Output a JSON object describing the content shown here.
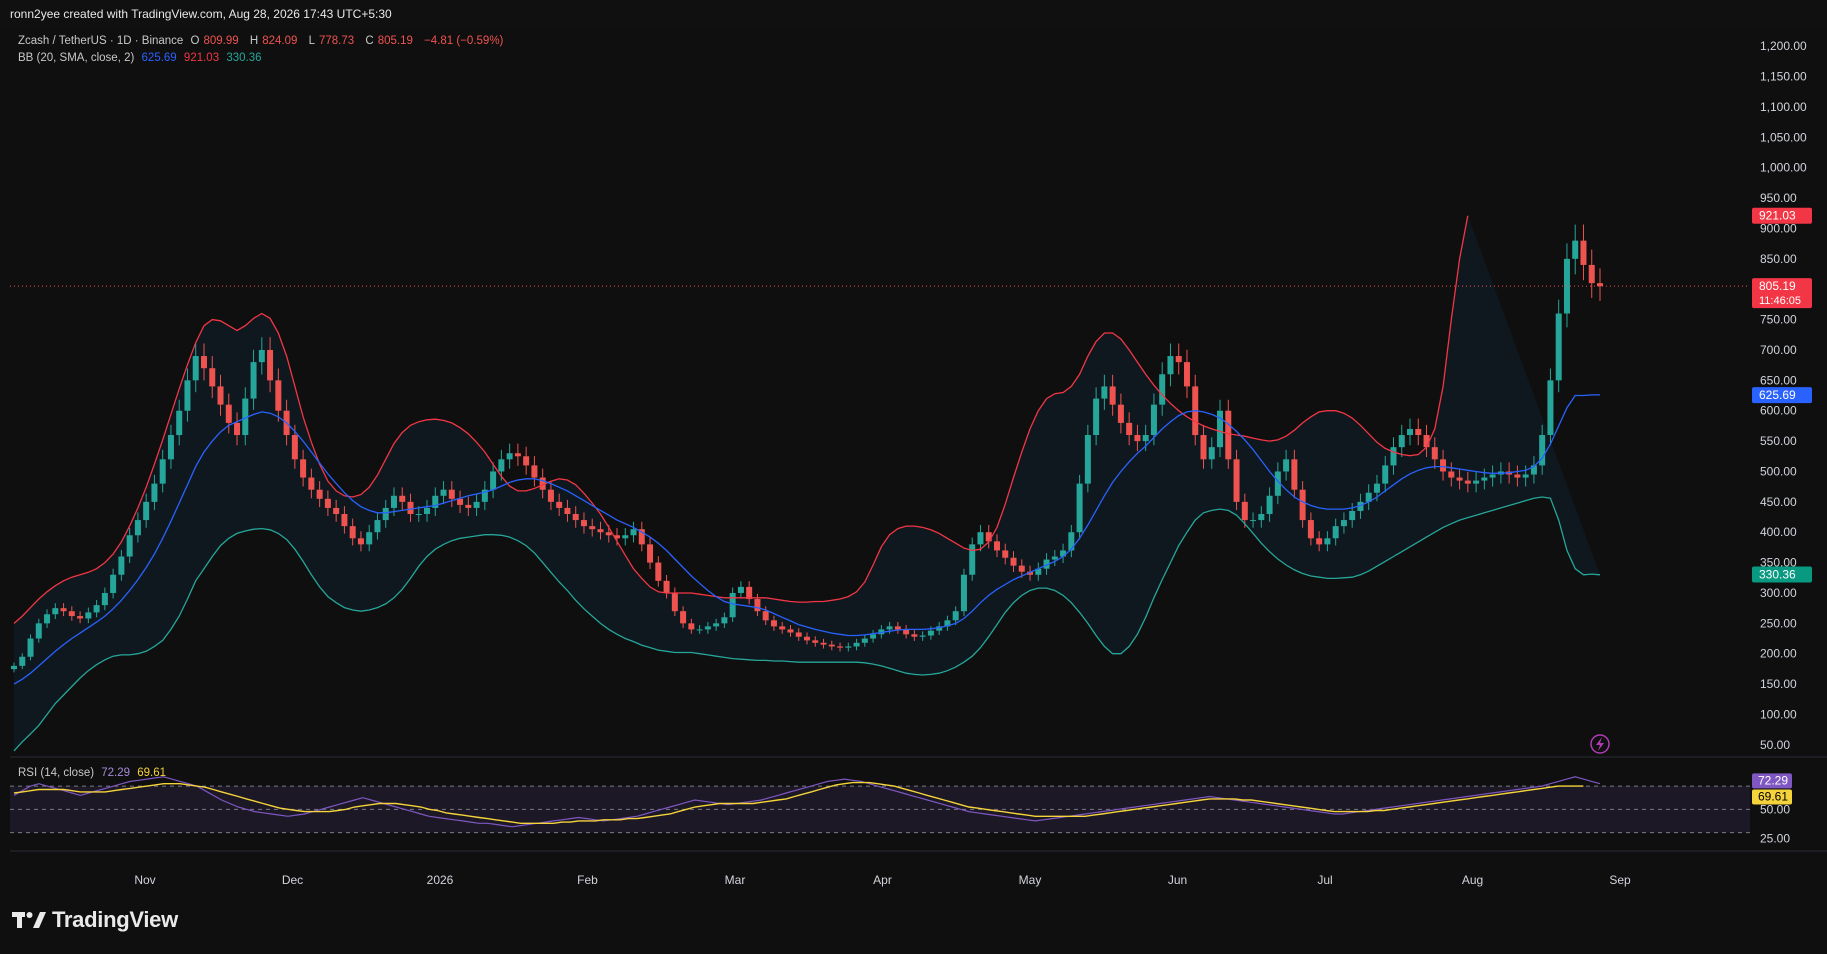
{
  "credit": "ronn2yee created with TradingView.com, Aug 28, 2026 17:43 UTC+5:30",
  "legend": {
    "symbol": "Zcash / TetherUS · 1D · Binance",
    "o_label": "O",
    "o_value": "809.99",
    "h_label": "H",
    "h_value": "824.09",
    "l_label": "L",
    "l_value": "778.73",
    "c_label": "C",
    "c_value": "805.19",
    "change": "−4.81 (−0.59%)",
    "bb_label": "BB (20, SMA, close, 2)",
    "bb_basis": "625.69",
    "bb_upper": "921.03",
    "bb_lower": "330.36",
    "rsi_label": "RSI (14, close)",
    "rsi_value": "72.29",
    "rsi_ma": "69.61"
  },
  "brand": {
    "name": "TradingView"
  },
  "colors": {
    "up": "#26a69a",
    "down": "#ef5350",
    "basis": "#2962ff",
    "upper": "#f23645",
    "lower": "#26a69a",
    "rsi": "#7e57c2",
    "rsi_ma": "#f5d33b"
  },
  "chart_data": {
    "type": "line",
    "price_axis": {
      "ticks": [
        "50.00",
        "100.00",
        "150.00",
        "200.00",
        "250.00",
        "300.00",
        "350.00",
        "400.00",
        "450.00",
        "500.00",
        "550.00",
        "600.00",
        "650.00",
        "700.00",
        "750.00",
        "800.00",
        "850.00",
        "900.00",
        "950.00",
        "1,000.00",
        "1,050.00",
        "1,100.00",
        "1,150.00",
        "1,200.00"
      ],
      "range": [
        30,
        1230
      ]
    },
    "x_axis": {
      "ticks": [
        "Nov",
        "Dec",
        "2026",
        "Feb",
        "Mar",
        "Apr",
        "May",
        "Jun",
        "Jul",
        "Aug",
        "Sep"
      ]
    },
    "price_labels": {
      "upper": "921.03",
      "last": "805.19",
      "countdown": "11:46:05",
      "basis": "625.69",
      "lower": "330.36"
    },
    "rsi_axis": {
      "ticks": [
        "25.00",
        "50.00"
      ],
      "range": [
        15,
        95
      ],
      "levels": [
        70,
        50,
        30
      ]
    },
    "rsi_labels": {
      "rsi": "72.29",
      "ma": "69.61"
    },
    "series": [
      {
        "name": "BB (20, SMA, close, 2)",
        "close": [
          180,
          195,
          225,
          250,
          265,
          275,
          270,
          262,
          258,
          268,
          280,
          300,
          330,
          360,
          395,
          420,
          450,
          480,
          520,
          560,
          600,
          650,
          690,
          670,
          640,
          610,
          580,
          560,
          620,
          680,
          700,
          650,
          600,
          560,
          520,
          490,
          470,
          455,
          440,
          430,
          410,
          390,
          380,
          400,
          420,
          440,
          460,
          450,
          430,
          430,
          440,
          460,
          470,
          455,
          445,
          440,
          450,
          470,
          500,
          520,
          530,
          525,
          510,
          490,
          470,
          450,
          440,
          430,
          420,
          410,
          405,
          400,
          395,
          390,
          395,
          405,
          380,
          350,
          320,
          300,
          270,
          250,
          240,
          240,
          245,
          250,
          260,
          300,
          310,
          290,
          270,
          255,
          245,
          240,
          235,
          228,
          222,
          218,
          215,
          212,
          210,
          212,
          218,
          225,
          232,
          240,
          245,
          240,
          232,
          228,
          230,
          238,
          245,
          255,
          270,
          330,
          380,
          400,
          385,
          370,
          358,
          345,
          335,
          330,
          340,
          355,
          360,
          370,
          400,
          480,
          560,
          620,
          640,
          610,
          580,
          560,
          550,
          560,
          610,
          660,
          690,
          680,
          640,
          560,
          520,
          540,
          600,
          520,
          450,
          420,
          420,
          430,
          460,
          500,
          520,
          470,
          420,
          390,
          380,
          390,
          410,
          420,
          435,
          450,
          465,
          480,
          510,
          540,
          560,
          570,
          560,
          540,
          520,
          500,
          490,
          485,
          480,
          485,
          490,
          495,
          500,
          495,
          490,
          495,
          510,
          560,
          650,
          760,
          850,
          880,
          840,
          810,
          805
        ],
        "basis": [
          150,
          158,
          168,
          180,
          192,
          204,
          215,
          225,
          234,
          243,
          252,
          262,
          274,
          288,
          304,
          322,
          342,
          364,
          390,
          418,
          448,
          478,
          508,
          532,
          550,
          565,
          576,
          582,
          588,
          594,
          598,
          596,
          590,
          580,
          566,
          550,
          532,
          514,
          496,
          480,
          465,
          452,
          442,
          436,
          432,
          432,
          434,
          436,
          438,
          440,
          442,
          444,
          448,
          452,
          456,
          460,
          463,
          466,
          470,
          476,
          482,
          486,
          488,
          488,
          485,
          480,
          474,
          468,
          460,
          452,
          444,
          436,
          428,
          420,
          414,
          408,
          400,
          392,
          382,
          370,
          356,
          342,
          328,
          316,
          304,
          294,
          286,
          282,
          280,
          278,
          276,
          272,
          266,
          260,
          254,
          248,
          244,
          240,
          237,
          234,
          232,
          230,
          230,
          231,
          233,
          235,
          237,
          239,
          240,
          240,
          240,
          241,
          243,
          246,
          250,
          258,
          270,
          284,
          296,
          306,
          314,
          322,
          328,
          334,
          340,
          346,
          352,
          360,
          372,
          390,
          412,
          436,
          460,
          482,
          500,
          516,
          530,
          542,
          556,
          570,
          582,
          592,
          598,
          600,
          598,
          594,
          588,
          578,
          566,
          552,
          536,
          518,
          500,
          484,
          470,
          458,
          450,
          444,
          440,
          438,
          438,
          438,
          440,
          444,
          450,
          458,
          468,
          478,
          488,
          496,
          502,
          506,
          508,
          508,
          506,
          504,
          502,
          500,
          498,
          497,
          497,
          498,
          500,
          502,
          508,
          522,
          545,
          575,
          605,
          625,
          625,
          626,
          626
        ],
        "upper": [
          250,
          262,
          276,
          290,
          302,
          312,
          320,
          326,
          330,
          334,
          340,
          350,
          364,
          384,
          410,
          440,
          474,
          512,
          552,
          594,
          636,
          676,
          712,
          740,
          750,
          748,
          740,
          732,
          740,
          752,
          760,
          752,
          728,
          690,
          640,
          590,
          548,
          512,
          484,
          468,
          460,
          458,
          462,
          474,
          494,
          520,
          546,
          564,
          576,
          582,
          585,
          586,
          584,
          580,
          572,
          562,
          548,
          532,
          512,
          492,
          476,
          468,
          468,
          472,
          478,
          484,
          488,
          486,
          478,
          464,
          448,
          430,
          408,
          385,
          362,
          340,
          324,
          310,
          302,
          300,
          300,
          300,
          300,
          298,
          296,
          294,
          292,
          292,
          292,
          292,
          292,
          292,
          290,
          288,
          286,
          285,
          285,
          286,
          286,
          288,
          290,
          294,
          302,
          318,
          346,
          376,
          396,
          406,
          410,
          410,
          408,
          404,
          398,
          390,
          382,
          374,
          370,
          372,
          384,
          408,
          446,
          490,
          532,
          570,
          600,
          620,
          628,
          630,
          640,
          660,
          690,
          714,
          728,
          728,
          718,
          700,
          680,
          660,
          642,
          626,
          612,
          600,
          590,
          582,
          575,
          570,
          566,
          562,
          560,
          558,
          555,
          552,
          550,
          552,
          558,
          568,
          580,
          590,
          598,
          600,
          600,
          596,
          588,
          576,
          562,
          548,
          538,
          532,
          528,
          526,
          528,
          540,
          570,
          640,
          750,
          850,
          921
        ],
        "lower": [
          40,
          55,
          68,
          82,
          100,
          118,
          132,
          146,
          160,
          172,
          182,
          190,
          196,
          198,
          198,
          200,
          204,
          212,
          222,
          240,
          262,
          290,
          320,
          340,
          360,
          378,
          390,
          398,
          402,
          405,
          406,
          404,
          398,
          388,
          372,
          352,
          330,
          310,
          294,
          284,
          276,
          272,
          270,
          272,
          276,
          282,
          292,
          306,
          324,
          344,
          360,
          372,
          380,
          386,
          390,
          392,
          394,
          396,
          396,
          395,
          392,
          386,
          378,
          366,
          350,
          334,
          318,
          304,
          288,
          274,
          262,
          250,
          240,
          232,
          225,
          220,
          214,
          210,
          206,
          204,
          202,
          202,
          202,
          200,
          198,
          196,
          194,
          192,
          191,
          190,
          189,
          189,
          188,
          188,
          187,
          186,
          186,
          186,
          186,
          186,
          186,
          186,
          186,
          185,
          183,
          180,
          176,
          172,
          168,
          166,
          165,
          166,
          168,
          172,
          178,
          186,
          196,
          210,
          228,
          248,
          268,
          284,
          296,
          304,
          308,
          308,
          304,
          296,
          284,
          268,
          250,
          230,
          212,
          200,
          200,
          212,
          232,
          260,
          292,
          322,
          350,
          378,
          400,
          420,
          432,
          436,
          438,
          436,
          428,
          414,
          398,
          382,
          368,
          356,
          346,
          338,
          332,
          328,
          326,
          324,
          324,
          325,
          326,
          330,
          336,
          344,
          352,
          360,
          368,
          376,
          384,
          392,
          400,
          408,
          414,
          420,
          424,
          428,
          432,
          436,
          440,
          444,
          448,
          452,
          456,
          458,
          456,
          420,
          370,
          340,
          330,
          331,
          330
        ]
      },
      {
        "name": "RSI (14, close)",
        "rsi": [
          62,
          66,
          70,
          72,
          70,
          68,
          66,
          64,
          62,
          64,
          66,
          68,
          70,
          72,
          74,
          75,
          76,
          77,
          78,
          76,
          74,
          72,
          70,
          66,
          62,
          58,
          55,
          52,
          50,
          48,
          47,
          46,
          45,
          44,
          45,
          46,
          48,
          50,
          52,
          54,
          56,
          58,
          60,
          58,
          56,
          54,
          52,
          50,
          48,
          46,
          44,
          43,
          42,
          41,
          40,
          39,
          38,
          38,
          37,
          36,
          35,
          36,
          37,
          38,
          39,
          40,
          41,
          42,
          43,
          42,
          41,
          40,
          41,
          42,
          43,
          44,
          46,
          48,
          50,
          52,
          54,
          56,
          58,
          57,
          56,
          55,
          54,
          55,
          56,
          57,
          58,
          60,
          62,
          64,
          66,
          68,
          70,
          72,
          74,
          75,
          76,
          75,
          74,
          72,
          70,
          68,
          66,
          64,
          62,
          60,
          58,
          56,
          54,
          52,
          50,
          48,
          47,
          46,
          45,
          44,
          43,
          42,
          41,
          40,
          41,
          42,
          43,
          44,
          45,
          46,
          47,
          48,
          49,
          50,
          51,
          52,
          53,
          54,
          55,
          56,
          57,
          58,
          59,
          60,
          61,
          60,
          59,
          58,
          57,
          56,
          55,
          54,
          53,
          52,
          51,
          50,
          49,
          48,
          47,
          46,
          46,
          47,
          48,
          49,
          50,
          51,
          52,
          53,
          54,
          55,
          56,
          57,
          58,
          59,
          60,
          61,
          62,
          63,
          64,
          65,
          66,
          67,
          68,
          69,
          70,
          72,
          74,
          76,
          78,
          76,
          74,
          72
        ],
        "rsi_ma": [
          64,
          65,
          66,
          67,
          67,
          67,
          67,
          66,
          65,
          65,
          65,
          65,
          66,
          67,
          68,
          69,
          70,
          71,
          72,
          72,
          72,
          71,
          70,
          69,
          67,
          65,
          63,
          61,
          59,
          57,
          55,
          53,
          51,
          50,
          49,
          48,
          48,
          48,
          48,
          49,
          50,
          52,
          53,
          54,
          55,
          55,
          55,
          54,
          53,
          52,
          50,
          49,
          47,
          46,
          45,
          44,
          43,
          42,
          41,
          40,
          39,
          38,
          38,
          38,
          38,
          38,
          39,
          39,
          40,
          40,
          40,
          41,
          41,
          41,
          42,
          42,
          43,
          44,
          45,
          46,
          48,
          50,
          52,
          53,
          54,
          55,
          55,
          55,
          55,
          55,
          56,
          57,
          58,
          59,
          61,
          63,
          65,
          67,
          69,
          71,
          72,
          73,
          73,
          73,
          72,
          71,
          70,
          68,
          66,
          64,
          62,
          60,
          58,
          56,
          54,
          52,
          51,
          50,
          49,
          48,
          47,
          46,
          45,
          44,
          44,
          44,
          44,
          44,
          44,
          44,
          45,
          46,
          47,
          48,
          49,
          50,
          51,
          52,
          53,
          54,
          55,
          56,
          57,
          58,
          59,
          59,
          59,
          59,
          58,
          58,
          57,
          56,
          55,
          54,
          53,
          52,
          51,
          50,
          49,
          48,
          48,
          48,
          48,
          48,
          49,
          49,
          50,
          51,
          52,
          53,
          54,
          55,
          56,
          57,
          58,
          59,
          60,
          61,
          62,
          63,
          64,
          65,
          66,
          67,
          68,
          69,
          70,
          70,
          70,
          70
        ]
      }
    ]
  }
}
